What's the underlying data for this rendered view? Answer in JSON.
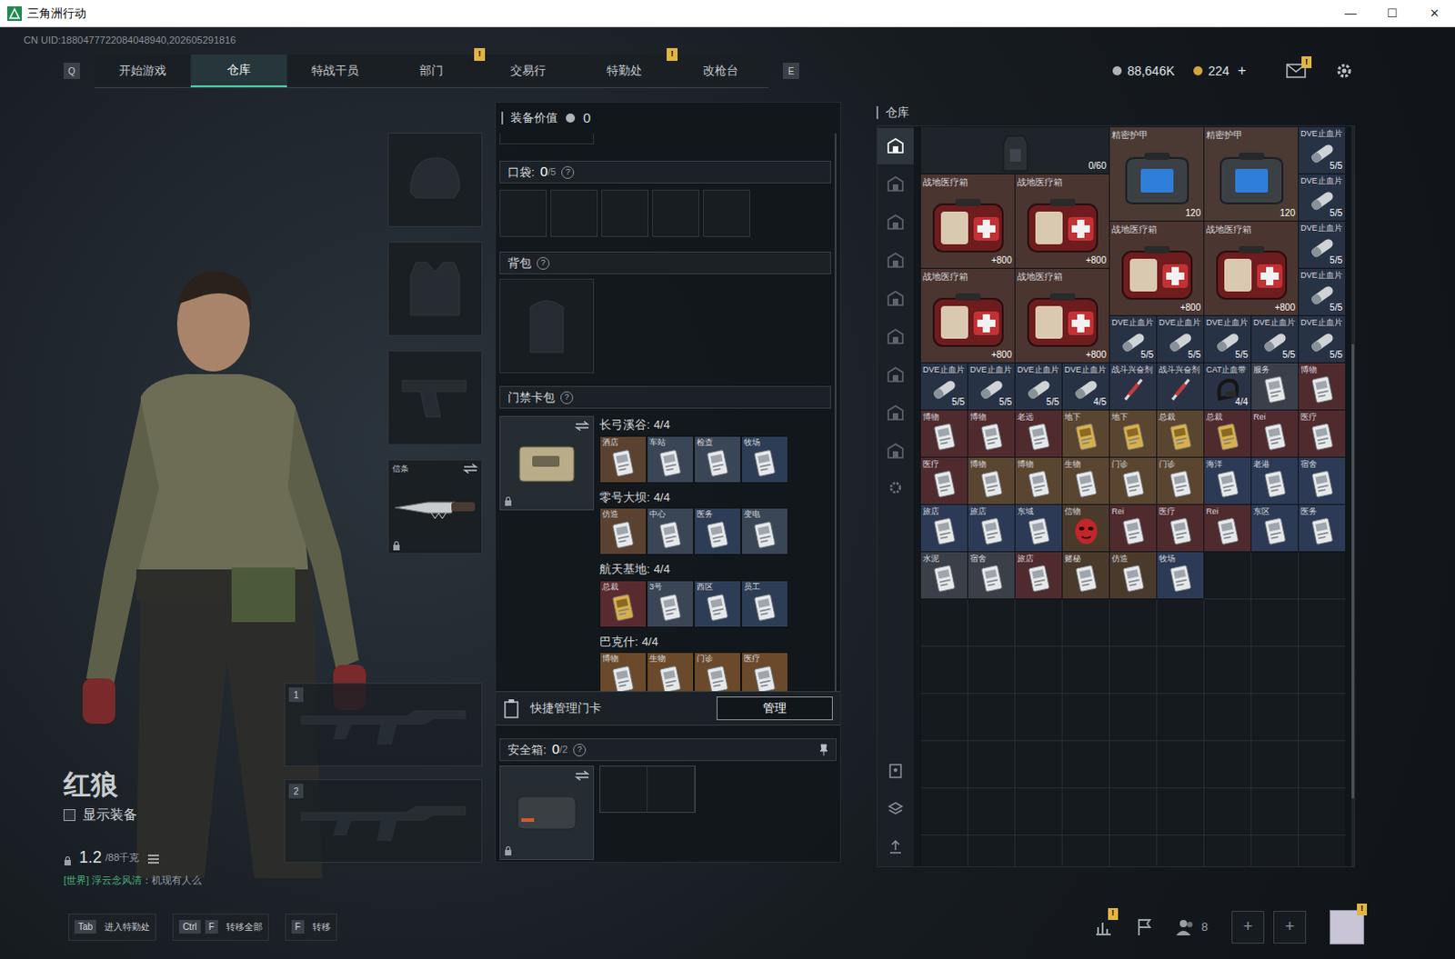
{
  "window": {
    "title": "三角洲行动",
    "controls": [
      "—",
      "☐",
      "✕"
    ]
  },
  "uid": "CN UID:1880477722084048940,202605291816",
  "nav": {
    "prev_key": "Q",
    "next_key": "E",
    "tabs": [
      {
        "label": "开始游戏",
        "selected": false,
        "badge": ""
      },
      {
        "label": "仓库",
        "selected": true,
        "badge": ""
      },
      {
        "label": "特战干员",
        "selected": false,
        "badge": ""
      },
      {
        "label": "部门",
        "selected": false,
        "badge": "!"
      },
      {
        "label": "交易行",
        "selected": false,
        "badge": ""
      },
      {
        "label": "特勤处",
        "selected": false,
        "badge": "!"
      },
      {
        "label": "改枪台",
        "selected": false,
        "badge": ""
      }
    ]
  },
  "currency": {
    "coins": "88,646K",
    "tickets": "224",
    "add": "+"
  },
  "mail": {
    "badge": "!"
  },
  "operator": {
    "name": "红狼",
    "show_gear": {
      "label": "显示装备",
      "checked": false
    },
    "weight": "1.2",
    "weight_max": "/88千克",
    "chat_channel": "[世界] 浮云念风清",
    "chat": "：机现有人么"
  },
  "gear_slots": [
    {
      "kind": "helmet",
      "label": "",
      "locked": false
    },
    {
      "kind": "armor",
      "label": "",
      "locked": false
    },
    {
      "kind": "pistol",
      "label": "",
      "locked": false
    },
    {
      "kind": "melee",
      "label": "信条",
      "locked": true
    }
  ],
  "weapon_slots": [
    {
      "number": "1"
    },
    {
      "number": "2"
    }
  ],
  "loadout": {
    "value_label": "装备价值",
    "value": "0",
    "pockets": {
      "label": "口袋:",
      "count": "0",
      "max": "/5",
      "help": "?",
      "slots": 5
    },
    "backpack": {
      "label": "背包",
      "help": "?"
    },
    "keycard_pack": {
      "label": "门禁卡包",
      "help": "?",
      "locked": true,
      "maps": [
        {
          "name": "长弓溪谷:",
          "count": "4/4",
          "cards": [
            {
              "label": "酒店",
              "kind": "card",
              "color": "#5b4230"
            },
            {
              "label": "车站",
              "kind": "card",
              "color": "#3a4656"
            },
            {
              "label": "检查",
              "kind": "card",
              "color": "#3a4656"
            },
            {
              "label": "牧场",
              "kind": "card",
              "color": "#2d3d55"
            }
          ]
        },
        {
          "name": "零号大坝:",
          "count": "4/4",
          "cards": [
            {
              "label": "仿造",
              "kind": "card",
              "color": "#5b4230"
            },
            {
              "label": "中心",
              "kind": "card",
              "color": "#3a4656"
            },
            {
              "label": "医务",
              "kind": "card",
              "color": "#2d3d55"
            },
            {
              "label": "变电",
              "kind": "card",
              "color": "#3a4656"
            }
          ]
        },
        {
          "name": "航天基地:",
          "count": "4/4",
          "cards": [
            {
              "label": "总裁",
              "kind": "gold_card",
              "color": "#5a2b2e"
            },
            {
              "label": "3号",
              "kind": "card",
              "color": "#3a4656"
            },
            {
              "label": "西区",
              "kind": "card",
              "color": "#2d3d55"
            },
            {
              "label": "员工",
              "kind": "card",
              "color": "#2d3d55"
            }
          ]
        },
        {
          "name": "巴克什:",
          "count": "4/4",
          "cards": [
            {
              "label": "博物",
              "kind": "card",
              "color": "#6a4a2a"
            },
            {
              "label": "生物",
              "kind": "card",
              "color": "#6a4a2a"
            },
            {
              "label": "门诊",
              "kind": "card",
              "color": "#6a4a2a"
            },
            {
              "label": "医疗",
              "kind": "card",
              "color": "#6a4a2a"
            }
          ]
        }
      ]
    },
    "quick_manage": {
      "label": "快捷管理门卡",
      "button": "管理"
    },
    "safe_box": {
      "label": "安全箱:",
      "count": "0",
      "max": "/2",
      "help": "?",
      "locked": true,
      "slots": 2
    }
  },
  "stash": {
    "title": "仓库",
    "side_tabs": [
      {
        "selected": true
      },
      {
        "selected": false
      },
      {
        "selected": false
      },
      {
        "selected": false
      },
      {
        "selected": false
      },
      {
        "selected": false
      },
      {
        "selected": false
      },
      {
        "selected": false
      },
      {
        "selected": false
      }
    ],
    "items": [
      {
        "name": "",
        "kind": "rig",
        "count": "0/60",
        "color": "#1e2429"
      },
      {
        "name": "精密护甲",
        "kind": "armor",
        "count": "120",
        "color": "#4a3a33"
      },
      {
        "name": "精密护甲",
        "kind": "armor",
        "count": "120",
        "color": "#4a3a33"
      },
      {
        "name": "DVE止血片",
        "kind": "bandage",
        "count": "5/5",
        "color": "#283245"
      },
      {
        "name": "战地医疗箱",
        "kind": "medkit",
        "count": "+800",
        "color": "#4b3530"
      },
      {
        "name": "战地医疗箱",
        "kind": "medkit",
        "count": "+800",
        "color": "#4b3530"
      },
      {
        "name": "DVE止血片",
        "kind": "bandage",
        "count": "5/5",
        "color": "#283245"
      },
      {
        "name": "战地医疗箱",
        "kind": "medkit",
        "count": "+800",
        "color": "#4b3530"
      },
      {
        "name": "战地医疗箱",
        "kind": "medkit",
        "count": "+800",
        "color": "#4b3530"
      },
      {
        "name": "DVE止血片",
        "kind": "bandage",
        "count": "5/5",
        "color": "#283245"
      },
      {
        "name": "战地医疗箱",
        "kind": "medkit",
        "count": "+800",
        "color": "#4b3530"
      },
      {
        "name": "战地医疗箱",
        "kind": "medkit",
        "count": "+800",
        "color": "#4b3530"
      },
      {
        "name": "DVE止血片",
        "kind": "bandage",
        "count": "5/5",
        "color": "#283245"
      },
      {
        "name": "DVE止血片",
        "kind": "bandage",
        "count": "5/5",
        "color": "#283245"
      },
      {
        "name": "DVE止血片",
        "kind": "bandage",
        "count": "5/5",
        "color": "#283245"
      },
      {
        "name": "DVE止血片",
        "kind": "bandage",
        "count": "5/5",
        "color": "#283245"
      },
      {
        "name": "DVE止血片",
        "kind": "bandage",
        "count": "5/5",
        "color": "#283245"
      },
      {
        "name": "DVE止血片",
        "kind": "bandage",
        "count": "5/5",
        "color": "#283245"
      },
      {
        "name": "DVE止血片",
        "kind": "bandage",
        "count": "5/5",
        "color": "#283245"
      },
      {
        "name": "DVE止血片",
        "kind": "bandage",
        "count": "5/5",
        "color": "#283245"
      },
      {
        "name": "DVE止血片",
        "kind": "bandage",
        "count": "5/5",
        "color": "#283245"
      },
      {
        "name": "DVE止血片",
        "kind": "bandage",
        "count": "4/5",
        "color": "#283245"
      },
      {
        "name": "战斗兴奋剂",
        "kind": "injector",
        "count": "",
        "color": "#2a3346"
      },
      {
        "name": "战斗兴奋剂",
        "kind": "injector",
        "count": "",
        "color": "#2a3346"
      },
      {
        "name": "CAT止血带",
        "kind": "tourniquet",
        "count": "4/4",
        "color": "#2a3346"
      },
      {
        "name": "服务",
        "kind": "card",
        "count": "",
        "color": "#3a3f4a"
      },
      {
        "name": "博物",
        "kind": "card",
        "count": "",
        "color": "#4f2b2e"
      },
      {
        "name": "博物",
        "kind": "card",
        "count": "",
        "color": "#4f2b2e"
      },
      {
        "name": "博物",
        "kind": "card",
        "count": "",
        "color": "#4f2b2e"
      },
      {
        "name": "老远",
        "kind": "card",
        "count": "",
        "color": "#4f2b2e"
      },
      {
        "name": "地下",
        "kind": "gold_card",
        "count": "",
        "color": "#5a4530"
      },
      {
        "name": "地下",
        "kind": "gold_card",
        "count": "",
        "color": "#5a4530"
      },
      {
        "name": "总裁",
        "kind": "gold_card",
        "count": "",
        "color": "#5a4530"
      },
      {
        "name": "总裁",
        "kind": "gold_card",
        "count": "",
        "color": "#4f2b2e"
      },
      {
        "name": "Rei",
        "kind": "card",
        "count": "",
        "color": "#4f2b2e"
      },
      {
        "name": "医疗",
        "kind": "card",
        "count": "",
        "color": "#4f2b2e"
      },
      {
        "name": "医疗",
        "kind": "card",
        "count": "",
        "color": "#4f2b2e"
      },
      {
        "name": "博物",
        "kind": "card",
        "count": "",
        "color": "#5a4530"
      },
      {
        "name": "博物",
        "kind": "card",
        "count": "",
        "color": "#5a4530"
      },
      {
        "name": "生物",
        "kind": "card",
        "count": "",
        "color": "#5a4530"
      },
      {
        "name": "门诊",
        "kind": "card",
        "count": "",
        "color": "#5a4530"
      },
      {
        "name": "门诊",
        "kind": "card",
        "count": "",
        "color": "#5a4530"
      },
      {
        "name": "海洋",
        "kind": "card",
        "count": "",
        "color": "#2c3a55"
      },
      {
        "name": "老港",
        "kind": "card",
        "count": "",
        "color": "#2c3a55"
      },
      {
        "name": "宿舍",
        "kind": "card",
        "count": "",
        "color": "#2c3a55"
      },
      {
        "name": "旅店",
        "kind": "card",
        "count": "",
        "color": "#2c3a55"
      },
      {
        "name": "旅店",
        "kind": "card",
        "count": "",
        "color": "#2c3a55"
      },
      {
        "name": "东域",
        "kind": "card",
        "count": "",
        "color": "#2c3a55"
      },
      {
        "name": "信物",
        "kind": "mask",
        "count": "",
        "color": "#4a3a2c"
      },
      {
        "name": "Rei",
        "kind": "card",
        "count": "",
        "color": "#4f2b2e"
      },
      {
        "name": "医疗",
        "kind": "card",
        "count": "",
        "color": "#4f2b2e"
      },
      {
        "name": "Rei",
        "kind": "card",
        "count": "",
        "color": "#4f2b2e"
      },
      {
        "name": "东区",
        "kind": "card",
        "count": "",
        "color": "#2c3a55"
      },
      {
        "name": "医务",
        "kind": "card",
        "count": "",
        "color": "#2c3a55"
      },
      {
        "name": "水泥",
        "kind": "card",
        "count": "",
        "color": "#3a3f48"
      },
      {
        "name": "宿舍",
        "kind": "card",
        "count": "",
        "color": "#3a3f48"
      },
      {
        "name": "旅店",
        "kind": "card",
        "count": "",
        "color": "#4f2b2e"
      },
      {
        "name": "赌秘",
        "kind": "card",
        "count": "",
        "color": "#4a3a2c"
      },
      {
        "name": "仿造",
        "kind": "card",
        "count": "",
        "color": "#4a3a2c"
      },
      {
        "name": "牧场",
        "kind": "card",
        "count": "",
        "color": "#2c3a55"
      }
    ]
  },
  "bottom_bar": {
    "hints": [
      {
        "keys": [
          "Tab"
        ],
        "label": "进入特勤处"
      },
      {
        "keys": [
          "Ctrl",
          "F"
        ],
        "label": "转移全部"
      },
      {
        "keys": [
          "F"
        ],
        "label": "转移"
      }
    ],
    "stats_badge": "!",
    "friends": "8",
    "add_buttons": [
      "+",
      "+"
    ],
    "avatar_badge": "!"
  }
}
